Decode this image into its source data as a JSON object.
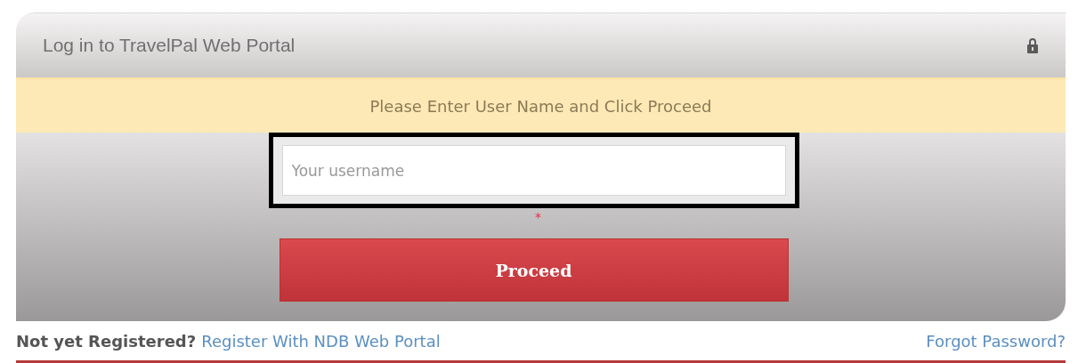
{
  "panel": {
    "title": "Log in to TravelPal Web Portal"
  },
  "banner": "Please Enter User Name and Click Proceed",
  "username_field": {
    "placeholder": "Your username",
    "required_mark": "*"
  },
  "proceed_button": "Proceed",
  "footer": {
    "prompt": "Not yet Registered?",
    "register_link": "Register With NDB Web Portal",
    "forgot_link": "Forgot Password?"
  }
}
